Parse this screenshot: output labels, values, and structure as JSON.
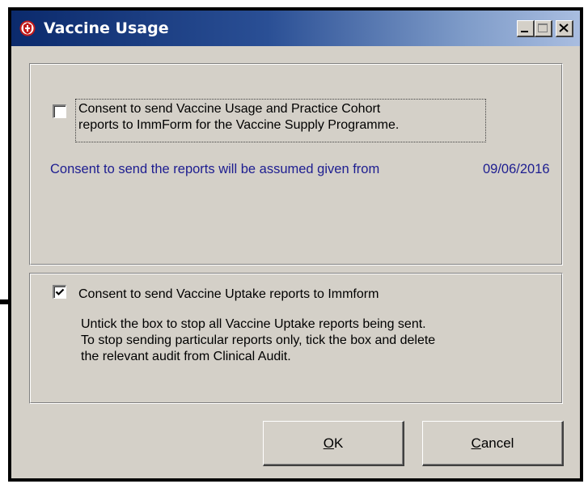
{
  "window": {
    "title": "Vaccine Usage"
  },
  "usage_group": {
    "checkbox_checked": false,
    "consent_line1": "Consent to send Vaccine Usage and Practice Cohort",
    "consent_line2": "reports to ImmForm for the Vaccine Supply Programme.",
    "assumed_label": "Consent to send the reports will be assumed given from",
    "assumed_date": "09/06/2016"
  },
  "uptake_group": {
    "checkbox_checked": true,
    "consent_label": "Consent to send Vaccine Uptake reports to Immform",
    "help_line1": "Untick the box to stop all Vaccine Uptake reports being sent.",
    "help_line2": "To stop sending particular reports only, tick the box and delete",
    "help_line3": "the relevant audit from Clinical Audit."
  },
  "buttons": {
    "ok_mnemonic": "O",
    "ok_rest": "K",
    "cancel_mnemonic": "C",
    "cancel_rest": "ancel"
  },
  "colors": {
    "info_text": "#1d1d90",
    "title_bar_start": "#0b2a6c",
    "title_bar_end": "#a9bde0"
  }
}
